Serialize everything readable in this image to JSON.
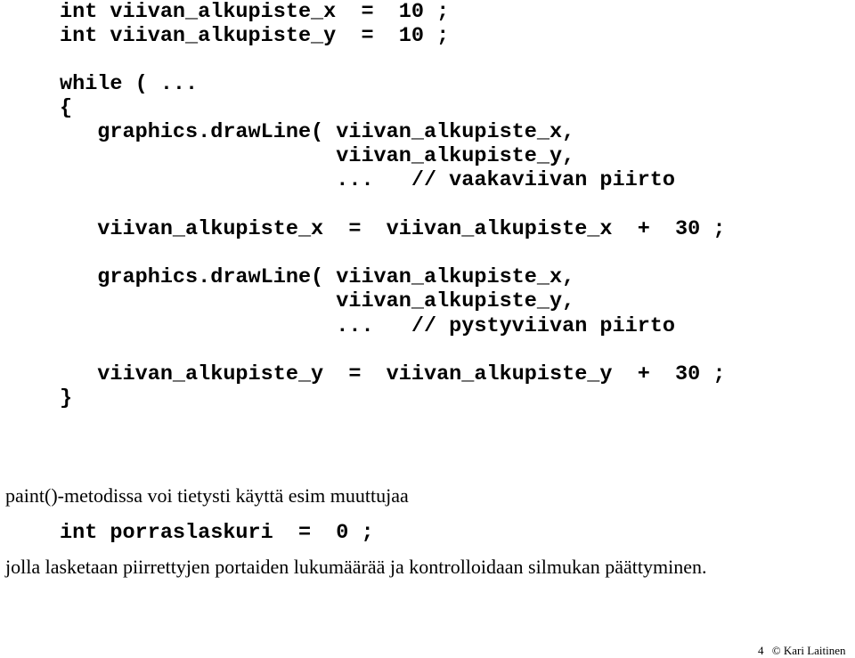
{
  "code_block": {
    "lines": [
      "int viivan_alkupiste_x  =  10 ;",
      "int viivan_alkupiste_y  =  10 ;",
      "",
      "while ( ...",
      "{",
      "   graphics.drawLine( viivan_alkupiste_x,",
      "                      viivan_alkupiste_y,",
      "                      ...   // vaakaviivan piirto",
      "",
      "   viivan_alkupiste_x  =  viivan_alkupiste_x  +  30 ;",
      "",
      "   graphics.drawLine( viivan_alkupiste_x,",
      "                      viivan_alkupiste_y,",
      "                      ...   // pystyviivan piirto",
      "",
      "   viivan_alkupiste_y  =  viivan_alkupiste_y  +  30 ;",
      "}"
    ]
  },
  "paragraph_1": "paint()-metodissa voi tietysti käyttä esim muuttujaa",
  "code_line_2": "int porraslaskuri  =  0 ;",
  "paragraph_2": "jolla lasketaan piirrettyjen portaiden lukumäärää ja kontrolloidaan silmukan päättyminen.",
  "footer": {
    "page_number": "4",
    "copyright": "© Kari Laitinen"
  }
}
